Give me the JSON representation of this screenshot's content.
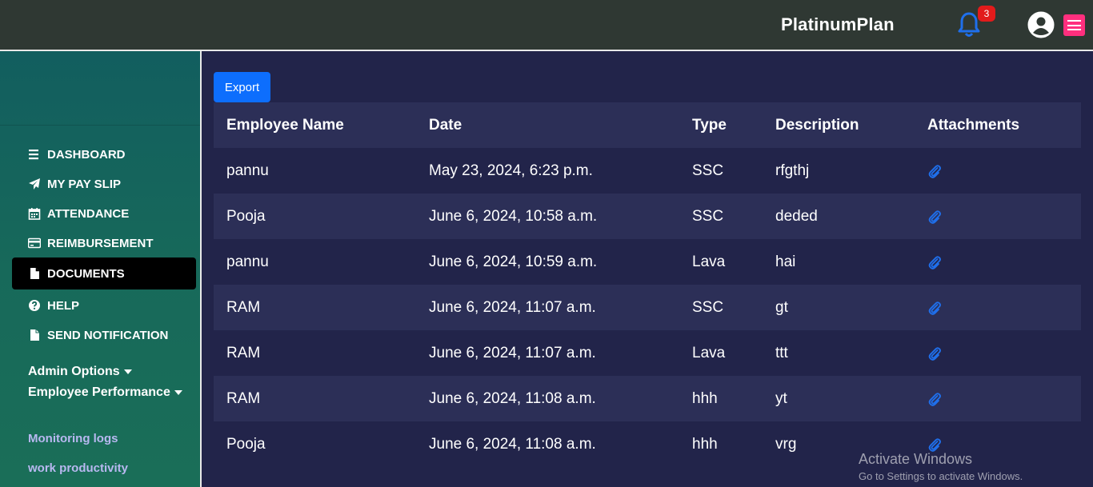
{
  "header": {
    "brand": "PlatinumPlan",
    "notification_count": "3",
    "icons": [
      "bell-icon",
      "user-circle-icon",
      "hamburger-menu-icon"
    ],
    "colors": {
      "topbar": "#2f3833",
      "bell": "#1f6feb",
      "badge": "#e21b1b",
      "menu_button": "#ff2f7e"
    }
  },
  "sidebar": {
    "items": [
      {
        "label": "DASHBOARD",
        "icon": "bars-icon"
      },
      {
        "label": "MY PAY SLIP",
        "icon": "paper-plane-icon"
      },
      {
        "label": "ATTENDANCE",
        "icon": "calendar-icon"
      },
      {
        "label": "REIMBURSEMENT",
        "icon": "credit-card-icon"
      },
      {
        "label": "DOCUMENTS",
        "icon": "file-icon",
        "active": true
      },
      {
        "label": "HELP",
        "icon": "question-circle-icon"
      },
      {
        "label": "SEND NOTIFICATION",
        "icon": "file-icon"
      }
    ],
    "admin_options": "Admin Options",
    "employee_performance": "Employee Performance",
    "links": [
      "Monitoring logs",
      "work productivity"
    ]
  },
  "main": {
    "export_label": "Export",
    "table": {
      "headers": [
        "Employee Name",
        "Date",
        "Type",
        "Description",
        "Attachments"
      ],
      "rows": [
        [
          "pannu",
          "May 23, 2024, 6:23 p.m.",
          "SSC",
          "rfgthj",
          "paperclip-icon"
        ],
        [
          "Pooja",
          "June 6, 2024, 10:58 a.m.",
          "SSC",
          "deded",
          "paperclip-icon"
        ],
        [
          "pannu",
          "June 6, 2024, 10:59 a.m.",
          "Lava",
          "hai",
          "paperclip-icon"
        ],
        [
          "RAM",
          "June 6, 2024, 11:07 a.m.",
          "SSC",
          "gt",
          "paperclip-icon"
        ],
        [
          "RAM",
          "June 6, 2024, 11:07 a.m.",
          "Lava",
          "ttt",
          "paperclip-icon"
        ],
        [
          "RAM",
          "June 6, 2024, 11:08 a.m.",
          "hhh",
          "yt",
          "paperclip-icon"
        ],
        [
          "Pooja",
          "June 6, 2024, 11:08 a.m.",
          "hhh",
          "vrg",
          "paperclip-icon"
        ]
      ]
    }
  },
  "watermark": {
    "title": "Activate Windows",
    "subtitle": "Go to Settings to activate Windows."
  }
}
